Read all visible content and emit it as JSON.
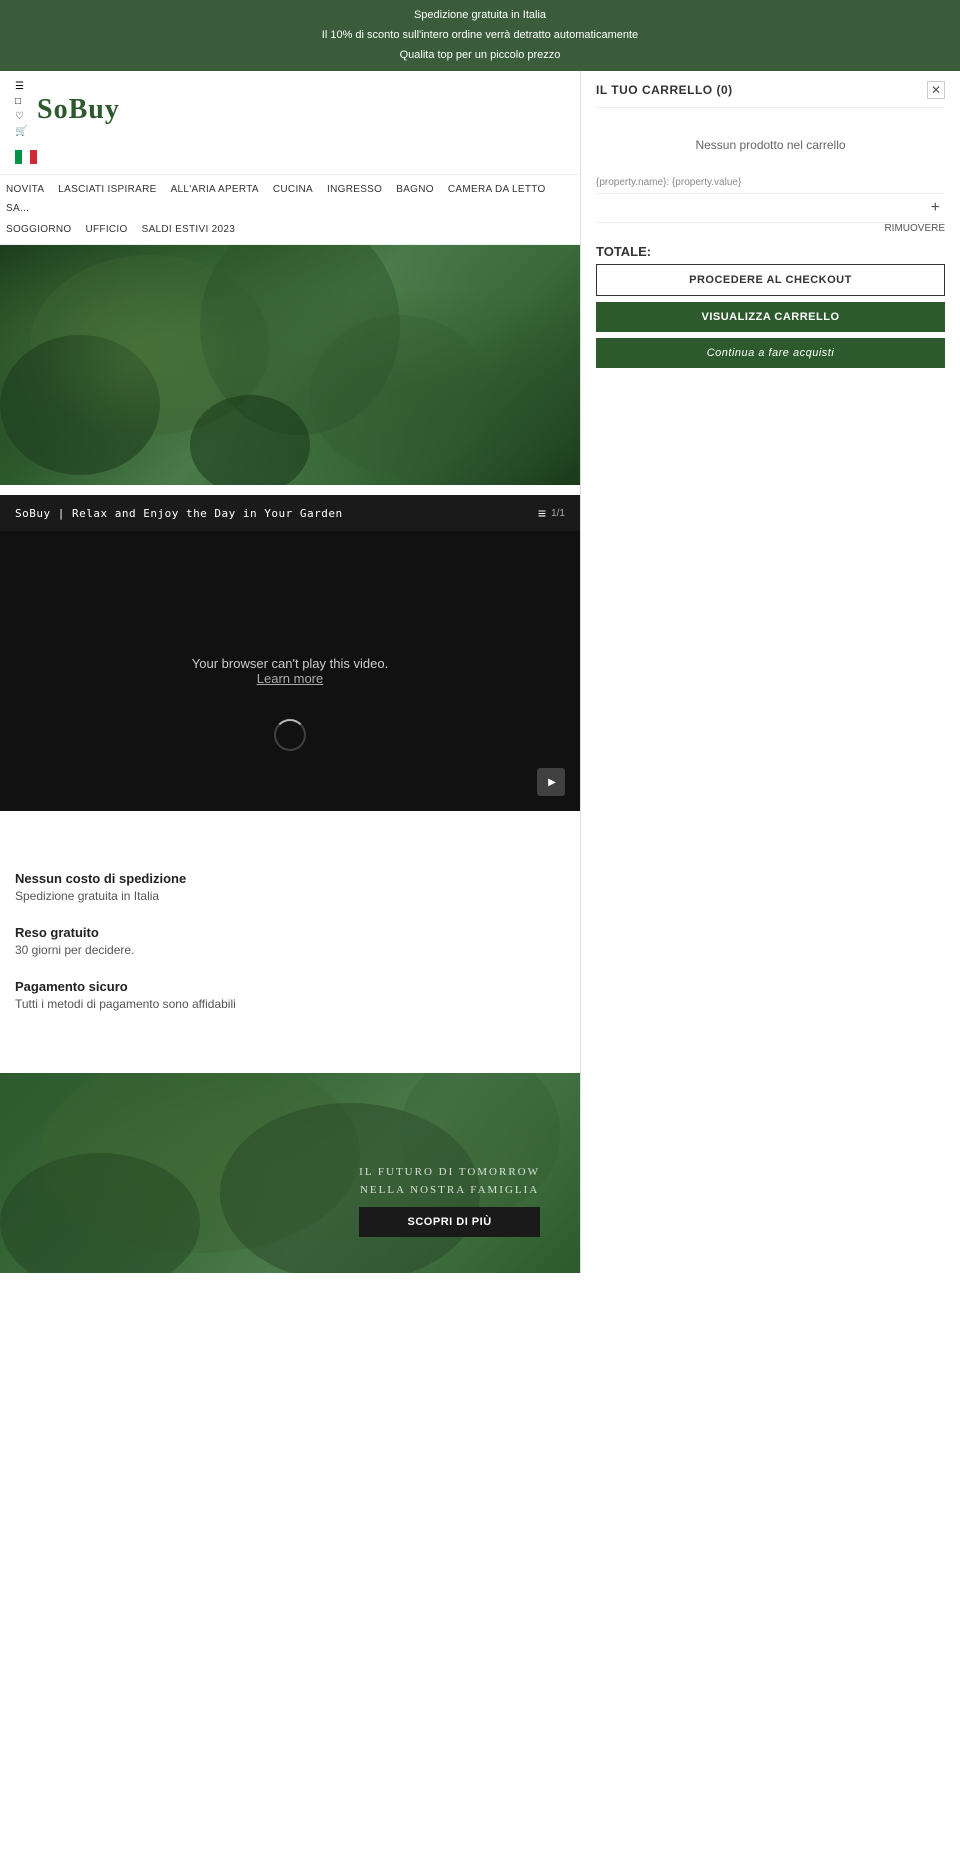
{
  "top_banner": {
    "line1": "Spedizione gratuita in Italia",
    "line2": "Il 10% di sconto sull'intero ordine verrà detratto automaticamente",
    "line3": "Qualita top per un piccolo prezzo"
  },
  "header": {
    "logo": "SoBuy",
    "icons": [
      "icon1",
      "icon2",
      "icon3",
      "icon4"
    ]
  },
  "nav": {
    "row1": [
      {
        "label": "NOVITA"
      },
      {
        "label": "LASCIATI ISPIRARE"
      },
      {
        "label": "ALL'ARIA APERTA"
      },
      {
        "label": "CUCINA"
      },
      {
        "label": "INGRESSO"
      },
      {
        "label": "BAGNO"
      },
      {
        "label": "CAMERA DA LETTO"
      },
      {
        "label": "SA..."
      }
    ],
    "row2": [
      {
        "label": "SOGGIORNO"
      },
      {
        "label": "UFFICIO"
      },
      {
        "label": "SALDI ESTIVI 2023"
      }
    ]
  },
  "video": {
    "title": "SoBuy | Relax and Enjoy the Day in Your Garden",
    "counter": "1/1",
    "error_text": "Your browser can't play this video.",
    "learn_more": "Learn more"
  },
  "features": [
    {
      "title": "Nessun costo di spedizione",
      "desc": "Spedizione gratuita in Italia"
    },
    {
      "title": "Reso gratuito",
      "desc": "30 giorni per decidere."
    },
    {
      "title": "Pagamento sicuro",
      "desc": "Tutti i metodi di pagamento sono affidabili"
    }
  ],
  "bottom_banner": {
    "text_lines": [
      "il futuro di tomorrow nella nostra famiglia"
    ],
    "button_label": "Scopri di più"
  },
  "cart": {
    "title": "IL TUO CARRELLO (0)",
    "empty_msg": "Nessun prodotto nel carrello",
    "property_placeholder": "{property.name}: {property.value}",
    "add_symbol": "+",
    "remove_label": "RIMUOVERE",
    "totale_label": "TOTALE:",
    "btn_checkout": "PROCEDERE AL CHECKOUT",
    "btn_view": "VISUALIZZA CARRELLO",
    "btn_continue": "Continua a fare acquisti"
  }
}
